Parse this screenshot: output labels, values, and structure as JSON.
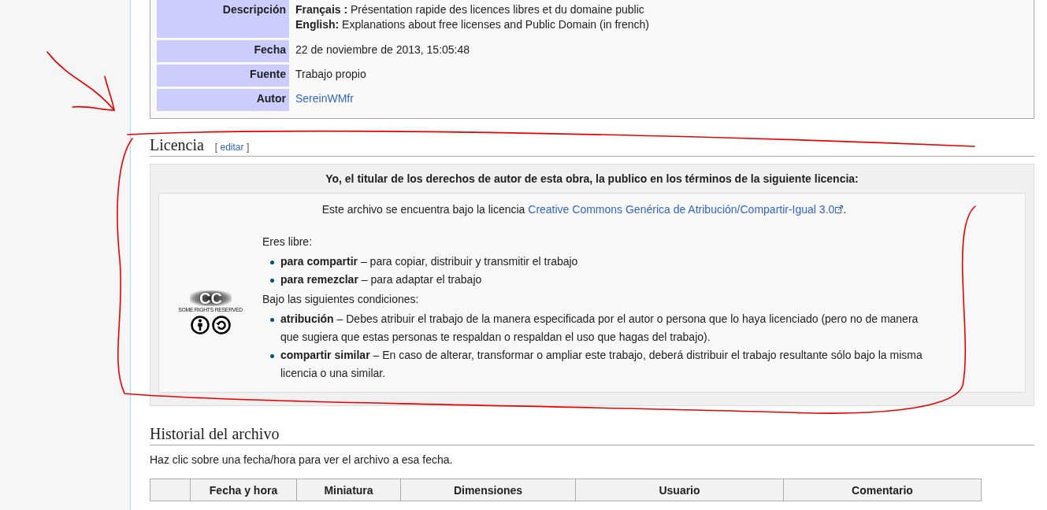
{
  "file_info": {
    "rows": [
      {
        "label": "Descripción",
        "kind": "text",
        "values": [
          "**Français :** Présentation rapide des licences libres et du domaine public",
          "**English:** Explanations about free licenses and Public Domain (in french)"
        ]
      },
      {
        "label": "Fecha",
        "kind": "text",
        "values": [
          "22 de noviembre de 2013, 15:05:48"
        ]
      },
      {
        "label": "Fuente",
        "kind": "text",
        "values": [
          "Trabajo propio"
        ]
      },
      {
        "label": "Autor",
        "kind": "link",
        "values": [
          "SereinWMfr"
        ]
      }
    ]
  },
  "license_section": {
    "heading": "Licencia",
    "edit_open": "[",
    "edit_link": "editar",
    "edit_close": "]",
    "statement": "Yo, el titular de los derechos de autor de esta obra, la publico en los términos de la siguiente licencia:",
    "notice_text": "Este archivo se encuentra bajo la licencia",
    "notice_link": "Creative Commons Genérica de Atribución/Compartir-Igual 3.0",
    "notice_end": ".",
    "badge": {
      "mark": "CC",
      "caption": "SOME RIGHTS RESERVED"
    },
    "freedoms_intro": "Eres libre:",
    "freedoms": [
      "**para compartir** – para copiar, distribuir y transmitir el trabajo",
      "**para remezclar** – para adaptar el trabajo"
    ],
    "conditions_intro": "Bajo las siguientes condiciones:",
    "conditions": [
      "**atribución** – Debes atribuir el trabajo de la manera especificada por el autor o persona que lo haya licenciado (pero no de manera que sugiera que estas personas te respaldan o respaldan el uso que hagas del trabajo).",
      "**compartir similar** – En caso de alterar, transformar o ampliar este trabajo, deberá distribuir el trabajo resultante sólo bajo la misma licencia o una similar."
    ]
  },
  "history": {
    "heading": "Historial del archivo",
    "hint": "Haz clic sobre una fecha/hora para ver el archivo a esa fecha.",
    "columns": [
      "Fecha y hora",
      "Miniatura",
      "Dimensiones",
      "Usuario",
      "Comentario"
    ]
  }
}
